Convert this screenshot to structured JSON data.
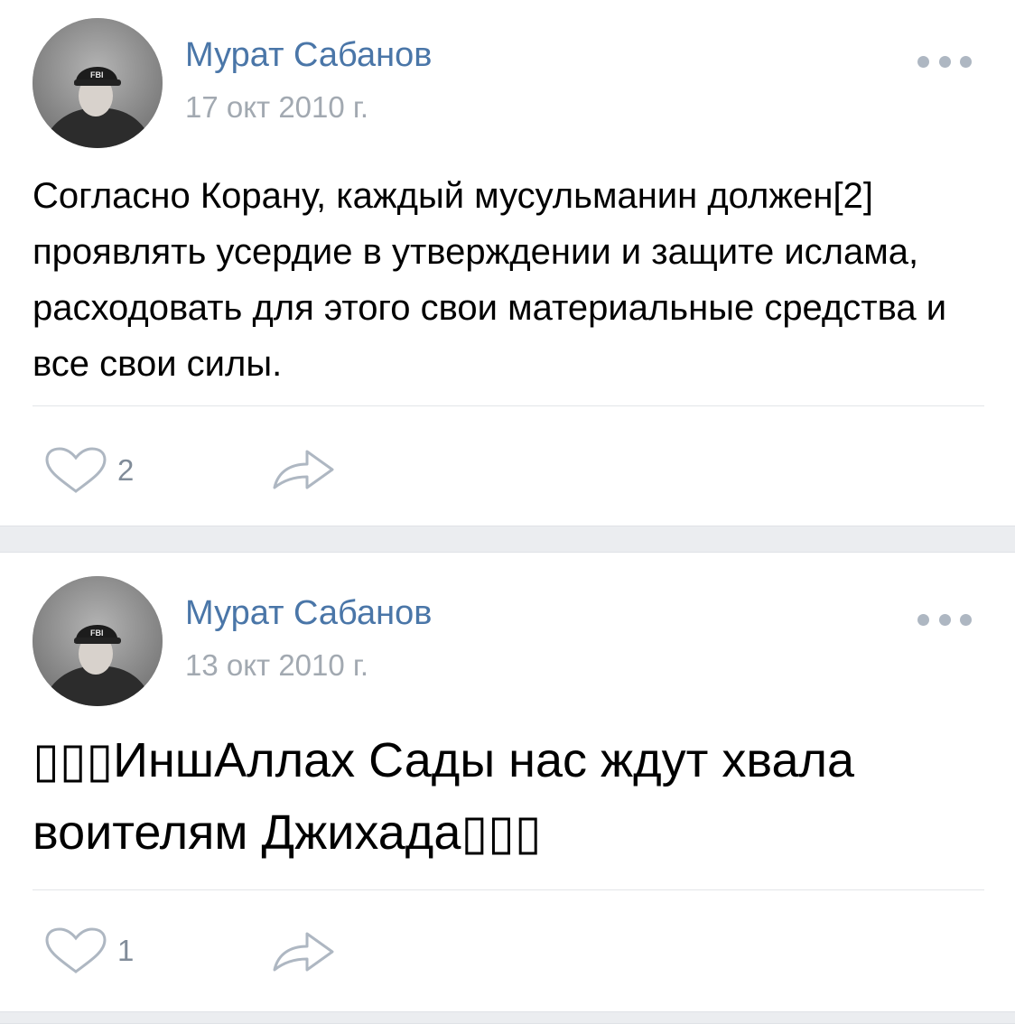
{
  "posts": [
    {
      "author": "Мурат Сабанов",
      "date": "17 окт 2010 г.",
      "text": "Согласно Корану, каждый мусульманин должен[2] проявлять усердие в утверждении и защите ислама, расходовать для этого свои материальные средства и все свои силы.",
      "likes": "2",
      "avatar_badge": "FBI"
    },
    {
      "author": "Мурат Сабанов",
      "date": "13 окт 2010 г.",
      "text": "▯▯▯ИншАллах Сады нас ждут хвала воителям Джихада▯▯▯",
      "likes": "1",
      "avatar_badge": "FBI"
    }
  ],
  "icons": {
    "more": "more-dots-icon",
    "like": "heart-icon",
    "share": "share-arrow-icon"
  },
  "colors": {
    "author": "#4a76a8",
    "date": "#a2a9b1",
    "icon": "#aeb7c2",
    "separator": "#ebedf0"
  }
}
